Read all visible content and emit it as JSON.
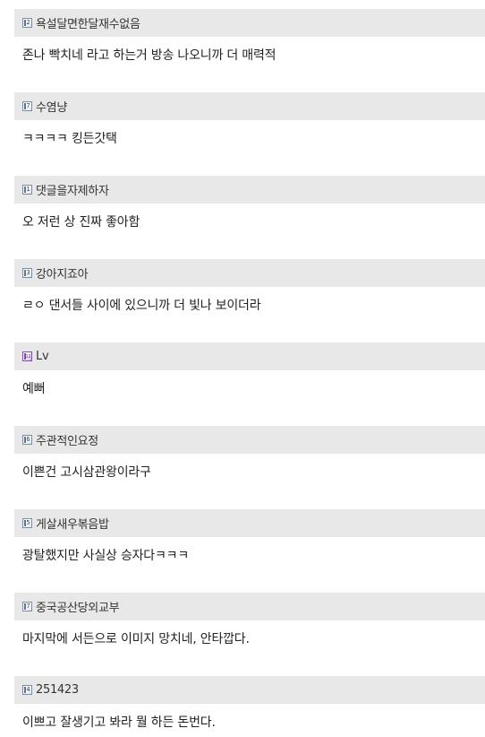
{
  "comments": [
    {
      "level": "2",
      "nickname": "욕설달면한달재수없음",
      "text": "존나 빡치네 라고 하는거 방송 나오니까 더 매력적"
    },
    {
      "level": "7",
      "nickname": "수염냥",
      "text": "ㅋㅋㅋㅋ 킹든갓택"
    },
    {
      "level": "1",
      "nickname": "댓글을자제하자",
      "text": "오 저런 상 진짜 좋아함"
    },
    {
      "level": "3",
      "nickname": "강아지죠아",
      "text": "ㄹㅇ 댄서들 사이에 있으니까 더 빛나 보이더라"
    },
    {
      "level": "12",
      "nickname": "Lv",
      "text": "예뻐"
    },
    {
      "level": "6",
      "nickname": "주관적인요정",
      "text": "이쁜건 고시삼관왕이라구"
    },
    {
      "level": "5",
      "nickname": "게살새우볶음밥",
      "text": "광탈했지만 사실상 승자다ㅋㅋㅋ"
    },
    {
      "level": "7",
      "nickname": "중국공산당외교부",
      "text": "마지막에 서든으로 이미지 망치네, 안타깝다."
    },
    {
      "level": "4",
      "nickname": "251423",
      "text": "이쁘고 잘생기고 봐라 뭘 하든 돈번다."
    }
  ],
  "colors": {
    "header_bg": "#e8e8e8",
    "text": "#222222",
    "level_icon_border": "#7a8ea8",
    "level_icon_special": "#7a4fb0"
  }
}
